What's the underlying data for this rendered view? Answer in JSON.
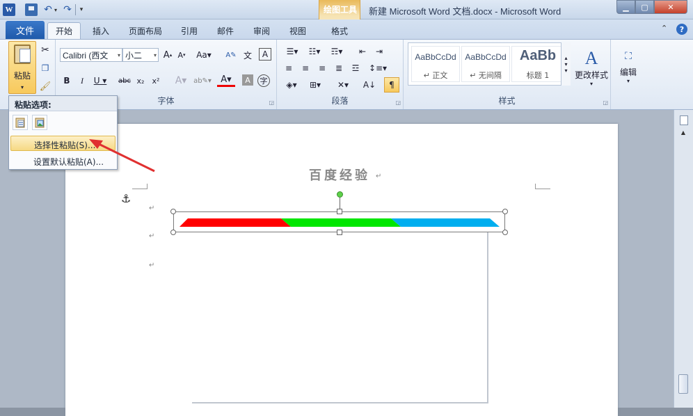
{
  "titlebar": {
    "window_title": "新建 Microsoft Word 文档.docx - Microsoft Word",
    "context_group_label": "绘图工具"
  },
  "tabs": {
    "file": "文件",
    "items": [
      "开始",
      "插入",
      "页面布局",
      "引用",
      "邮件",
      "审阅",
      "视图"
    ],
    "context_tab": "格式"
  },
  "ribbon": {
    "clipboard": {
      "paste_label": "粘贴"
    },
    "font": {
      "group_label": "字体",
      "font_name": "Calibri (西文",
      "font_size": "小二"
    },
    "paragraph": {
      "group_label": "段落"
    },
    "styles": {
      "group_label": "样式",
      "samples": [
        {
          "sample": "AaBbCcDd",
          "name": "↵ 正文"
        },
        {
          "sample": "AaBbCcDd",
          "name": "↵ 无间隔"
        },
        {
          "sample": "AaBb",
          "name": "标题 1"
        }
      ],
      "change_styles": "更改样式"
    },
    "editing": {
      "label": "编辑"
    }
  },
  "paste_menu": {
    "header": "粘贴选项:",
    "items": [
      "选择性粘贴(S)...",
      "设置默认粘贴(A)..."
    ]
  },
  "document": {
    "title": "百度经验",
    "para_mark": "↵",
    "shape_colors": [
      "#ff0000",
      "#00e600",
      "#00aeef"
    ]
  },
  "colors": {
    "accent": "#2a5ba8",
    "highlight": "#f6d984",
    "arrow": "#e03030"
  }
}
